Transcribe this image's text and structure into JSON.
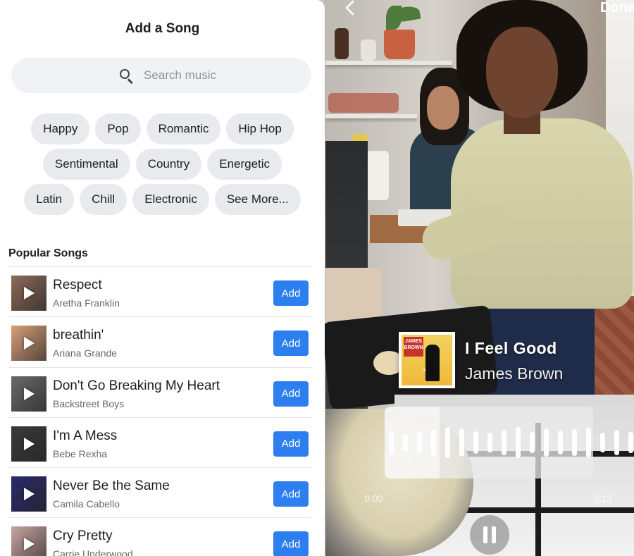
{
  "panel": {
    "title": "Add a Song",
    "search": {
      "placeholder": "Search music",
      "value": ""
    },
    "genres": [
      [
        "Happy",
        "Pop",
        "Romantic",
        "Hip Hop"
      ],
      [
        "Sentimental",
        "Country",
        "Energetic"
      ],
      [
        "Latin",
        "Chill",
        "Electronic",
        "See More..."
      ]
    ],
    "popular_label": "Popular Songs",
    "songs": [
      {
        "title": "Respect",
        "artist": "Aretha Franklin",
        "add_label": "Add",
        "cover_color": "#8e6a5a"
      },
      {
        "title": "breathin'",
        "artist": "Ariana Grande",
        "add_label": "Add",
        "cover_color": "#d9a07a"
      },
      {
        "title": "Don't Go Breaking My Heart",
        "artist": "Backstreet Boys",
        "add_label": "Add",
        "cover_color": "#6a6a6a"
      },
      {
        "title": "I'm A Mess",
        "artist": "Bebe Rexha",
        "add_label": "Add",
        "cover_color": "#3a3a3a"
      },
      {
        "title": "Never Be the Same",
        "artist": "Camila Cabello",
        "add_label": "Add",
        "cover_color": "#2a2a6a"
      },
      {
        "title": "Cry Pretty",
        "artist": "Carrie Underwood",
        "add_label": "Add",
        "cover_color": "#c9a5a0"
      }
    ]
  },
  "player": {
    "back_icon": "chevron-left-icon",
    "done_label": "Done",
    "now_playing": {
      "title": "I Feel Good",
      "artist": "James Brown"
    },
    "time_start": "0:00",
    "time_end": "0:13",
    "pause_icon": "pause-icon"
  },
  "colors": {
    "accent": "#2d7ff0",
    "chip_bg": "#e8eaed",
    "search_bg": "#f0f2f5"
  }
}
